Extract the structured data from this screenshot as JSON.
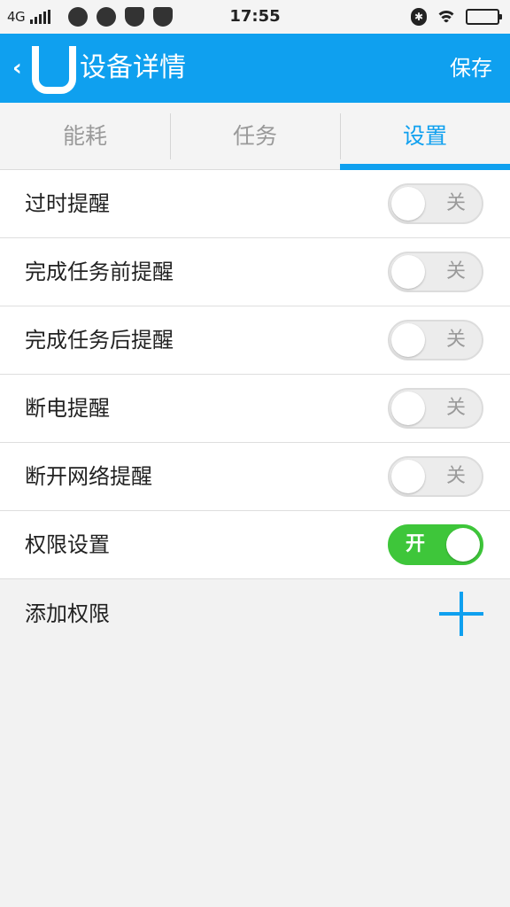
{
  "status_bar": {
    "network": "4G",
    "time": "17:55",
    "icons": [
      "signal-icon",
      "weibo-icon",
      "wechat-icon",
      "shield-icon",
      "shield-icon",
      "bluetooth-icon",
      "wifi-icon",
      "battery-icon"
    ]
  },
  "header": {
    "title": "设备详情",
    "save_label": "保存",
    "logo_letter": "U",
    "background_color": "#0fa0ef"
  },
  "tabs": [
    {
      "label": "能耗",
      "active": false
    },
    {
      "label": "任务",
      "active": false
    },
    {
      "label": "设置",
      "active": true
    }
  ],
  "settings": [
    {
      "label": "过时提醒",
      "state": "关",
      "on": false
    },
    {
      "label": "完成任务前提醒",
      "state": "关",
      "on": false
    },
    {
      "label": "完成任务后提醒",
      "state": "关",
      "on": false
    },
    {
      "label": "断电提醒",
      "state": "关",
      "on": false
    },
    {
      "label": "断开网络提醒",
      "state": "关",
      "on": false
    },
    {
      "label": "权限设置",
      "state": "开",
      "on": true
    }
  ],
  "add_permission": {
    "label": "添加权限",
    "icon": "plus-icon"
  },
  "colors": {
    "accent": "#0fa0ef",
    "toggle_on": "#3ec63a",
    "toggle_off": "#ececec"
  }
}
